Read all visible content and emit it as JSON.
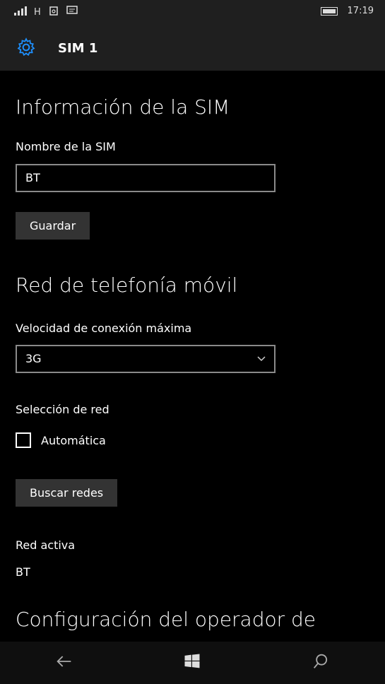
{
  "status": {
    "network_type": "H",
    "time": "17:19"
  },
  "header": {
    "title": "SIM 1",
    "icon": "gear-icon"
  },
  "sim_info": {
    "heading": "Información de la SIM",
    "name_label": "Nombre de la SIM",
    "name_value": "BT",
    "save_button": "Guardar"
  },
  "mobile_network": {
    "heading": "Red de telefonía móvil",
    "max_speed_label": "Velocidad de conexión máxima",
    "max_speed_value": "3G",
    "network_selection_label": "Selección de red",
    "automatic_label": "Automática",
    "automatic_checked": false,
    "search_button": "Buscar redes",
    "active_network_label": "Red activa",
    "active_network_value": "BT"
  },
  "operator_config": {
    "heading": "Configuración del operador de"
  },
  "navbar": {
    "back_icon": "back-arrow-icon",
    "home_icon": "windows-logo-icon",
    "search_icon": "search-icon"
  },
  "colors": {
    "accent": "#1e90ff",
    "background": "#000000",
    "header_bg": "#1f1f1f",
    "button_bg": "#333333"
  }
}
